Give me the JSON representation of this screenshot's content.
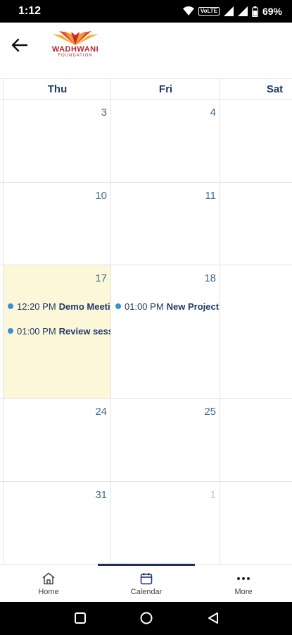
{
  "status_bar": {
    "time": "1:12",
    "network": "VoLTE",
    "battery": "69%"
  },
  "header": {
    "logo_name": "WADHWANI",
    "logo_sub": "FOUNDATION"
  },
  "days": [
    "Thu",
    "Fri",
    "Sat"
  ],
  "weeks": [
    {
      "dates": [
        "3",
        "4",
        ""
      ]
    },
    {
      "dates": [
        "10",
        "11",
        ""
      ]
    },
    {
      "dates": [
        "17",
        "18",
        ""
      ]
    },
    {
      "dates": [
        "24",
        "25",
        ""
      ]
    },
    {
      "dates": [
        "31",
        "1",
        ""
      ]
    }
  ],
  "events": {
    "thu17": [
      {
        "time": "12:20 PM",
        "title": "Demo Meeting"
      },
      {
        "time": "01:00 PM",
        "title": "Review session"
      }
    ],
    "fri18": [
      {
        "time": "01:00 PM",
        "title": "New Project"
      }
    ]
  },
  "nav": [
    {
      "label": "Home"
    },
    {
      "label": "Calendar"
    },
    {
      "label": "More"
    }
  ],
  "colors": {
    "accent": "#1f2e6b",
    "today_bg": "#fcf7d8",
    "event_dot": "#3b8ed6",
    "logo": "#b8262e"
  }
}
